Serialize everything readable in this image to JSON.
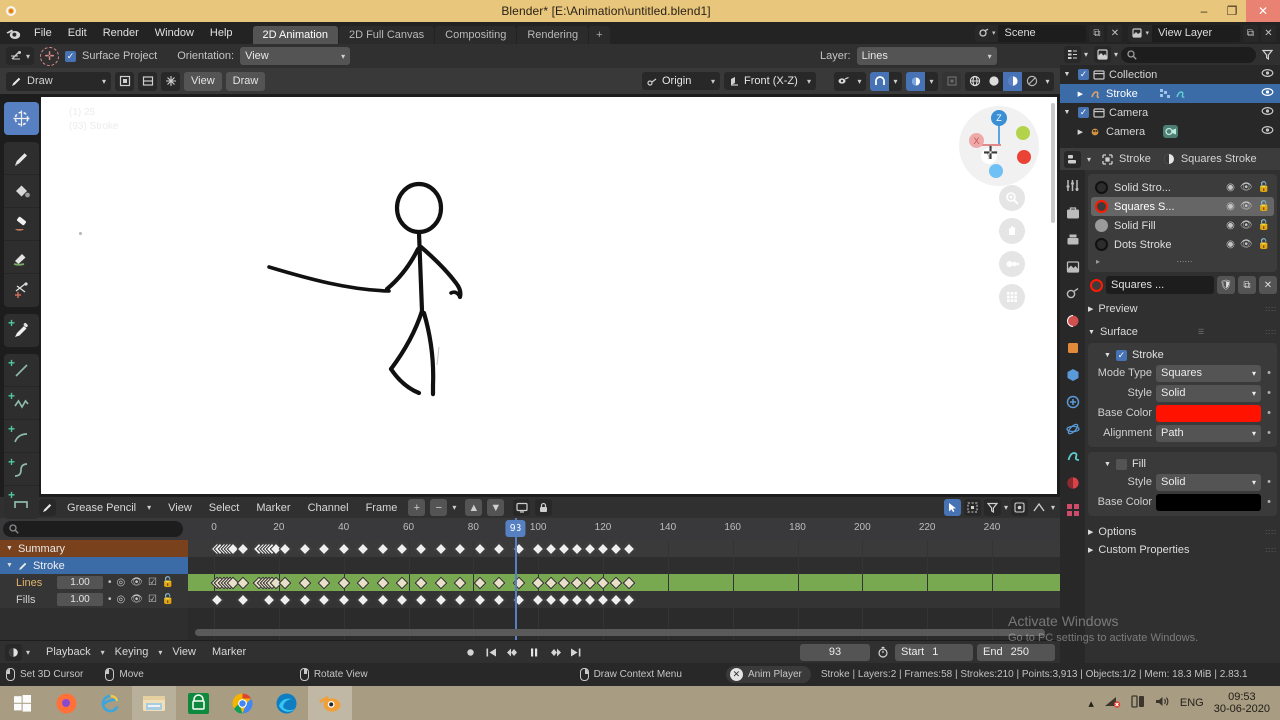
{
  "window": {
    "title": "Blender* [E:\\Animation\\untitled.blend1]",
    "minimize": "–",
    "maximize": "❐",
    "close": "✕"
  },
  "menubar": {
    "items": [
      "File",
      "Edit",
      "Render",
      "Window",
      "Help"
    ],
    "workspaces": [
      {
        "label": "2D Animation",
        "active": true
      },
      {
        "label": "2D Full Canvas",
        "active": false
      },
      {
        "label": "Compositing",
        "active": false
      },
      {
        "label": "Rendering",
        "active": false
      }
    ],
    "add_workspace": "+",
    "scene_label": "Scene",
    "viewlayer_label": "View Layer",
    "copy_icon": "copy-icon",
    "x_icon": "✕"
  },
  "tool_settings": {
    "surface_project_label": "Surface Project",
    "surface_project_checked": true,
    "orientation_label": "Orientation:",
    "orientation_value": "View",
    "layer_label": "Layer:",
    "layer_value": "Lines"
  },
  "viewport_header": {
    "mode": "Draw",
    "view_menu": "View",
    "draw_menu": "Draw",
    "pivot": "Origin",
    "view_orientation": "Front (X-Z)"
  },
  "viewport": {
    "info_line1": "(1) 25",
    "info_line2": "(93) Stroke",
    "gizmo_axes": [
      "Z",
      "Y",
      "X"
    ],
    "nav_buttons": [
      "zoom-icon",
      "hand-icon",
      "camera-icon",
      "grid-icon"
    ]
  },
  "left_tools": [
    {
      "name": "cursor-tool",
      "selected": true
    },
    {
      "name": "draw-tool",
      "selected": false
    },
    {
      "name": "fill-tool",
      "selected": false
    },
    {
      "name": "erase-tool",
      "selected": false
    },
    {
      "name": "tint-tool",
      "selected": false
    },
    {
      "name": "cutter-tool",
      "selected": false
    },
    {
      "name": "eyedropper-tool",
      "selected": false
    },
    {
      "name": "line-tool",
      "selected": false
    },
    {
      "name": "polyline-tool",
      "selected": false
    },
    {
      "name": "arc-tool",
      "selected": false
    },
    {
      "name": "curve-tool",
      "selected": false
    },
    {
      "name": "box-tool",
      "selected": false
    }
  ],
  "outliner": {
    "search_placeholder": "",
    "rows": [
      {
        "label": "Collection",
        "type": "collection",
        "indent": 0,
        "selected": false,
        "checkbox": true,
        "expand": "▼"
      },
      {
        "label": "Stroke",
        "type": "gpencil",
        "indent": 1,
        "selected": true,
        "checkbox": false,
        "expand": "▶"
      },
      {
        "label": "Camera",
        "type": "collection",
        "indent": 0,
        "selected": false,
        "checkbox": true,
        "expand": "▼"
      },
      {
        "label": "Camera",
        "type": "camera",
        "indent": 1,
        "selected": false,
        "checkbox": false,
        "expand": "▶"
      }
    ]
  },
  "properties": {
    "breadcrumb_object": "Stroke",
    "breadcrumb_material": "Squares Stroke",
    "material_slots": [
      {
        "label": "Solid Stro...",
        "color": "#111111",
        "ring": "#111111",
        "selected": false
      },
      {
        "label": "Squares S...",
        "color": "#3a3a3a",
        "ring": "#ff1a00",
        "selected": true
      },
      {
        "label": "Solid Fill",
        "color": "#9a9a9a",
        "ring": "#9a9a9a",
        "selected": false
      },
      {
        "label": "Dots Stroke",
        "color": "#111111",
        "ring": "#111111",
        "selected": false
      }
    ],
    "active_material_name": "Squares ...",
    "sections": {
      "preview": "Preview",
      "surface": "Surface",
      "stroke": "Stroke",
      "fill": "Fill",
      "options": "Options",
      "custom_properties": "Custom Properties"
    },
    "stroke_checked": true,
    "fill_checked": false,
    "stroke_props": [
      {
        "label": "Mode Type",
        "value": "Squares",
        "kind": "dropdown"
      },
      {
        "label": "Style",
        "value": "Solid",
        "kind": "dropdown"
      },
      {
        "label": "Base Color",
        "value": "#ff1200",
        "kind": "color"
      },
      {
        "label": "Alignment",
        "value": "Path",
        "kind": "dropdown"
      }
    ],
    "fill_props": [
      {
        "label": "Style",
        "value": "Solid",
        "kind": "dropdown"
      },
      {
        "label": "Base Color",
        "value": "#000000",
        "kind": "color"
      }
    ]
  },
  "dopesheet": {
    "editor_mode": "Grease Pencil",
    "menus": [
      "View",
      "Select",
      "Marker",
      "Channel",
      "Frame"
    ],
    "ruler_ticks": [
      {
        "label": "0",
        "frame": 0
      },
      {
        "label": "20",
        "frame": 20
      },
      {
        "label": "40",
        "frame": 40
      },
      {
        "label": "60",
        "frame": 60
      },
      {
        "label": "80",
        "frame": 80
      },
      {
        "label": "100",
        "frame": 100
      },
      {
        "label": "120",
        "frame": 120
      },
      {
        "label": "140",
        "frame": 140
      },
      {
        "label": "160",
        "frame": 160
      },
      {
        "label": "180",
        "frame": 180
      },
      {
        "label": "200",
        "frame": 200
      },
      {
        "label": "220",
        "frame": 220
      },
      {
        "label": "240",
        "frame": 240
      }
    ],
    "current_frame": 93,
    "channels": [
      {
        "label": "Summary",
        "type": "summary",
        "value": null
      },
      {
        "label": "Stroke",
        "type": "object",
        "value": null
      },
      {
        "label": "Lines",
        "type": "layer",
        "value": "1.00",
        "highlight": true
      },
      {
        "label": "Fills",
        "type": "layer",
        "value": "1.00",
        "highlight": false
      }
    ],
    "keyframes_lines": [
      1,
      2,
      3,
      4,
      5,
      6,
      9,
      14,
      15,
      16,
      17,
      18,
      19,
      22,
      28,
      34,
      40,
      46,
      52,
      58,
      64,
      70,
      76,
      82,
      88,
      94,
      100,
      104,
      108,
      112,
      116,
      120,
      124,
      128
    ],
    "keyframes_fills": [
      1,
      9,
      17,
      22,
      28,
      34,
      40,
      46,
      52,
      58,
      64,
      70,
      76,
      82,
      88,
      94,
      100,
      104,
      108,
      112,
      116,
      120,
      124,
      128
    ],
    "search_placeholder": ""
  },
  "playbar": {
    "playback_label": "Playback",
    "keying_label": "Keying",
    "view_label": "View",
    "marker_label": "Marker",
    "current_frame": "93",
    "start_label": "Start",
    "start_value": "1",
    "end_label": "End",
    "end_value": "250"
  },
  "statusbar": {
    "hints": [
      {
        "icon": "mouse-left-icon",
        "label": "Set 3D Cursor"
      },
      {
        "icon": "mouse-move-icon",
        "label": "Move"
      },
      {
        "icon": "mouse-middle-icon",
        "label": "Rotate View"
      },
      {
        "icon": "mouse-right-icon",
        "label": "Draw Context Menu"
      }
    ],
    "anim_player": "Anim Player",
    "stats": "Stroke | Layers:2 | Frames:58 | Strokes:210 | Points:3,913 | Objects:1/2 | Mem: 18.3 MiB | 2.83.1"
  },
  "watermark": {
    "line1": "Activate Windows",
    "line2": "Go to PC settings to activate Windows."
  },
  "taskbar": {
    "apps": [
      {
        "name": "start-button"
      },
      {
        "name": "firefox-icon"
      },
      {
        "name": "internet-explorer-icon"
      },
      {
        "name": "file-explorer-icon"
      },
      {
        "name": "microsoft-store-icon"
      },
      {
        "name": "chrome-icon"
      },
      {
        "name": "edge-icon"
      },
      {
        "name": "blender-icon"
      }
    ],
    "language": "ENG",
    "time": "09:53",
    "date": "30-06-2020"
  },
  "colors": {
    "accent_blue": "#4772b3",
    "selected_blue": "#3b6ca8",
    "summary_orange": "#79421c",
    "layer_green": "#78a951",
    "title_tan": "#e8c67b",
    "base_color_red": "#ff1200"
  }
}
